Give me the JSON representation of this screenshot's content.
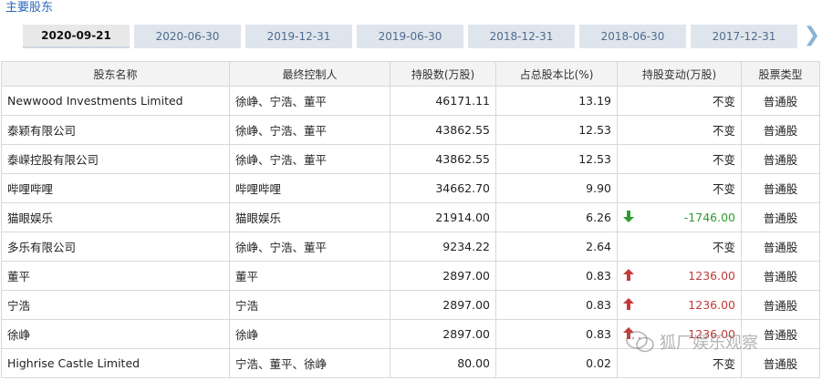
{
  "section_title": "主要股东",
  "tabs": [
    "2020-09-21",
    "2020-06-30",
    "2019-12-31",
    "2019-06-30",
    "2018-12-31",
    "2018-06-30",
    "2017-12-31"
  ],
  "headers": {
    "name": "股东名称",
    "controller": "最终控制人",
    "shares": "持股数(万股)",
    "ratio": "占总股本比(%)",
    "change": "持股变动(万股)",
    "type": "股票类型"
  },
  "rows": [
    {
      "name": "Newwood Investments Limited",
      "controller": "徐峥、宁浩、董平",
      "shares": "46171.11",
      "ratio": "13.19",
      "change": "不变",
      "trend": "none",
      "type": "普通股"
    },
    {
      "name": "泰颖有限公司",
      "controller": "徐峥、宁浩、董平",
      "shares": "43862.55",
      "ratio": "12.53",
      "change": "不变",
      "trend": "none",
      "type": "普通股"
    },
    {
      "name": "泰嵘控股有限公司",
      "controller": "徐峥、宁浩、董平",
      "shares": "43862.55",
      "ratio": "12.53",
      "change": "不变",
      "trend": "none",
      "type": "普通股"
    },
    {
      "name": "哔哩哔哩",
      "controller": "哔哩哔哩",
      "shares": "34662.70",
      "ratio": "9.90",
      "change": "不变",
      "trend": "none",
      "type": "普通股"
    },
    {
      "name": "猫眼娱乐",
      "controller": "猫眼娱乐",
      "shares": "21914.00",
      "ratio": "6.26",
      "change": "-1746.00",
      "trend": "down",
      "type": "普通股"
    },
    {
      "name": "多乐有限公司",
      "controller": "徐峥、宁浩、董平",
      "shares": "9234.22",
      "ratio": "2.64",
      "change": "不变",
      "trend": "none",
      "type": "普通股"
    },
    {
      "name": "董平",
      "controller": "董平",
      "shares": "2897.00",
      "ratio": "0.83",
      "change": "1236.00",
      "trend": "up",
      "type": "普通股"
    },
    {
      "name": "宁浩",
      "controller": "宁浩",
      "shares": "2897.00",
      "ratio": "0.83",
      "change": "1236.00",
      "trend": "up",
      "type": "普通股"
    },
    {
      "name": "徐峥",
      "controller": "徐峥",
      "shares": "2897.00",
      "ratio": "0.83",
      "change": "1236.00",
      "trend": "up",
      "type": "普通股"
    },
    {
      "name": "Highrise Castle Limited",
      "controller": "宁浩、董平、徐峥",
      "shares": "80.00",
      "ratio": "0.02",
      "change": "不变",
      "trend": "none",
      "type": "普通股"
    }
  ],
  "watermark": "狐厂娱乐观察",
  "colors": {
    "link": "#2b67b7",
    "up": "#c23a3a",
    "down": "#2e9b2e"
  }
}
